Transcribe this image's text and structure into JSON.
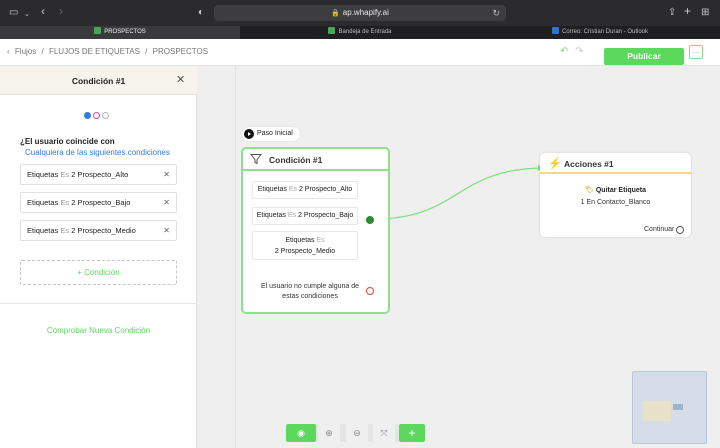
{
  "browser": {
    "url": "ap.whapify.ai",
    "tabs": [
      {
        "label": "PROSPECTOS",
        "favicon_color": "#4aa55a",
        "active": true
      },
      {
        "label": "Bandeja de Entrada",
        "favicon_color": "#4aa55a",
        "active": false
      },
      {
        "label": "Correo: Cristian Duran - Outlook",
        "favicon_color": "#2f74c9",
        "active": false
      }
    ]
  },
  "header": {
    "breadcrumbs": [
      "Flujos",
      "FLUJOS DE ETIQUETAS",
      "PROSPECTOS"
    ],
    "publish_label": "Publicar",
    "more_label": "..."
  },
  "panel": {
    "title": "Condición #1",
    "channels": [
      {
        "icon": "messenger-icon",
        "color": "#2f7dd8"
      },
      {
        "icon": "instagram-icon",
        "color": "#d94b8a"
      },
      {
        "icon": "chat-bubble-icon",
        "color": "#b7b7b7"
      }
    ],
    "match_question": "¿El usuario coincide con",
    "match_mode": "Cualquiera de las siguientes condiciones",
    "conditions": [
      {
        "field": "Etiquetas",
        "op": "Es",
        "value": "2 Prospecto_Alto"
      },
      {
        "field": "Etiquetas",
        "op": "Es",
        "value": "2 Prospecto_Bajo"
      },
      {
        "field": "Etiquetas",
        "op": "Es",
        "value": "2 Prospecto_Medio"
      }
    ],
    "add_condition": "+ Condición",
    "check_new": "Comprobar Nueva Condición"
  },
  "canvas": {
    "start_label": "Paso Inicial",
    "condition_node": {
      "title": "Condición #1",
      "pills": [
        {
          "field": "Etiquetas",
          "op": "Es",
          "value": "2 Prospecto_Alto"
        },
        {
          "field": "Etiquetas",
          "op": "Es",
          "value": "2 Prospecto_Bajo"
        },
        {
          "field": "Etiquetas",
          "op": "Es",
          "value": "2 Prospecto_Medio"
        }
      ],
      "fail_text_1": "El usuario no cumple alguna de",
      "fail_text_2": "estas condiciones",
      "success_color": "#2f8a2f",
      "fail_color": "#e0413a"
    },
    "action_node": {
      "title": "Acciones #1",
      "action_name": "Quitar Etiqueta",
      "action_detail": "1 En Contacto_Blanco",
      "continue_label": "Continuar"
    }
  },
  "toolbar": {
    "buttons": [
      "eye-icon",
      "zoom-in-icon",
      "zoom-out-icon",
      "fit-icon",
      "add-icon"
    ]
  },
  "colors": {
    "accent": "#5cd85c",
    "link": "#2f7dd8",
    "node_border": "#8ee38a",
    "action_accent": "#f5d878"
  }
}
